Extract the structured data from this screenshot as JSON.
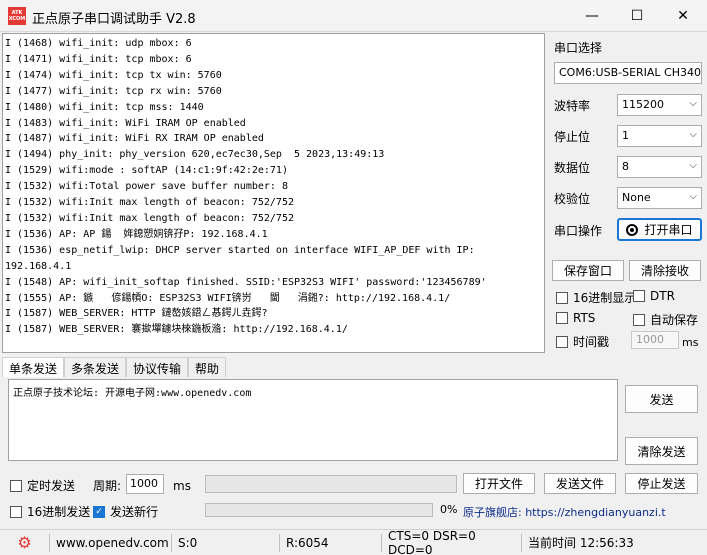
{
  "app": {
    "title": "正点原子串口调试助手 V2.8",
    "logo_top": "ATK",
    "logo_bottom": "XCOM"
  },
  "window_controls": {
    "minimize": "—",
    "maximize": "☐",
    "close": "✕"
  },
  "receive": {
    "lines": [
      "I (1468) wifi_init: udp mbox: 6",
      "I (1471) wifi_init: tcp mbox: 6",
      "I (1474) wifi_init: tcp tx win: 5760",
      "I (1477) wifi_init: tcp rx win: 5760",
      "I (1480) wifi_init: tcp mss: 1440",
      "I (1483) wifi_init: WiFi IRAM OP enabled",
      "I (1487) wifi_init: WiFi RX IRAM OP enabled",
      "I (1494) phy_init: phy_version 620,ec7ec30,Sep  5 2023,13:49:13",
      "I (1529) wifi:mode : softAP (14:c1:9f:42:2e:71)",
      "I (1532) wifi:Total power save buffer number: 8",
      "I (1532) wifi:Init max length of beacon: 752/752",
      "I (1532) wifi:Init max length of beacon: 752/752",
      "I (1536) AP: AP 鍚  姩鎴愬姛锛孖P: 192.168.4.1",
      "I (1536) esp_netif_lwip: DHCP server started on interface WIFI_AP_DEF with IP:",
      "192.168.4.1",
      "I (1548) AP: wifi_init_softap finished. SSID:'ESP32S3 WIFI' password:'123456789'",
      "I (1555) AP: 鏃   偐鍚幊O: ESP32S3 WIFI锛岃   閫   涓鎺?: http://192.168.4.1/",
      "I (1587) WEB_SERVER: HTTP 鏈嶅姟鍣ㄥ惎鍔ㄦ垚鍔?",
      "I (1587) WEB_SERVER: 褰撳墠鐪块棶鍦板潃: http://192.168.4.1/"
    ]
  },
  "port": {
    "section_label": "串口选择",
    "port_value": "COM6:USB-SERIAL CH340",
    "baud_label": "波特率",
    "baud_value": "115200",
    "stop_label": "停止位",
    "stop_value": "1",
    "data_label": "数据位",
    "data_value": "8",
    "parity_label": "校验位",
    "parity_value": "None",
    "op_label": "串口操作",
    "open_button": "打开串口"
  },
  "recv_controls": {
    "save_window": "保存窗口",
    "clear_recv": "清除接收",
    "hex_display": "16进制显示",
    "dtr": "DTR",
    "rts": "RTS",
    "auto_save": "自动保存",
    "timestamp": "时间戳",
    "timestamp_value": "1000",
    "timestamp_unit": "ms"
  },
  "tabs": [
    "单条发送",
    "多条发送",
    "协议传输",
    "帮助"
  ],
  "send": {
    "text": "正点原子技术论坛: 开源电子网:www.openedv.com",
    "send_button": "发送",
    "clear_send": "清除发送",
    "timed_send": "定时发送",
    "period_label": "周期:",
    "period_value": "1000",
    "period_unit": "ms",
    "open_file": "打开文件",
    "send_file": "发送文件",
    "stop_send": "停止发送",
    "hex_send": "16进制发送",
    "send_newline": "发送新行",
    "progress_percent": "0%",
    "store_link": "原子旗舰店: https://zhengdianyuanzi.t"
  },
  "status": {
    "website": "www.openedv.com",
    "sent": "S:0",
    "received": "R:6054",
    "lines": "CTS=0 DSR=0 DCD=0",
    "time": "当前时间 12:56:33"
  },
  "colors": {
    "accent": "#1976d2",
    "gear": "#e53935"
  }
}
